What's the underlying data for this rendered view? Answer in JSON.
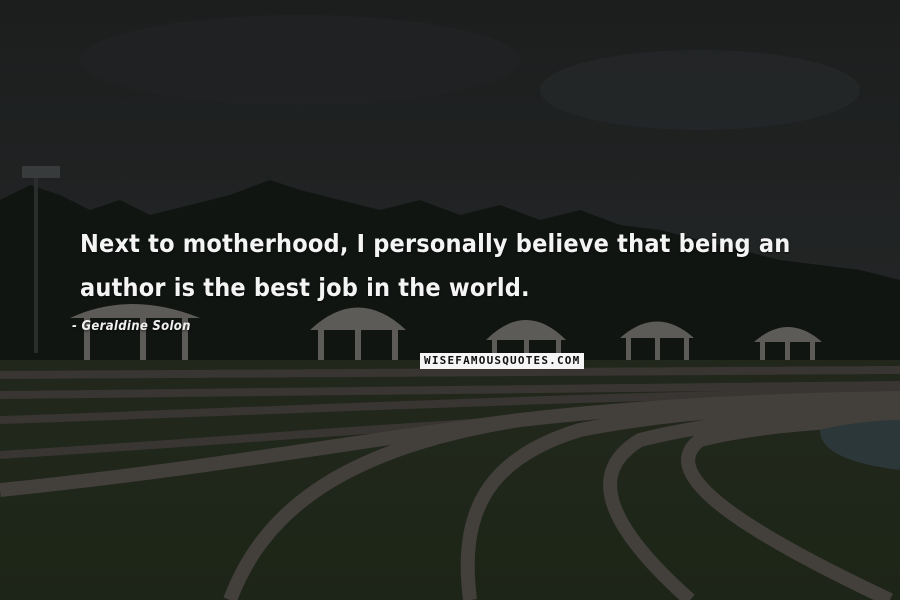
{
  "quote": {
    "text": "Next to motherhood, I personally believe that being an author is the best job in the world.",
    "author": "- Geraldine Solon"
  },
  "watermark": {
    "text": "WISEFAMOUSQUOTES.COM"
  },
  "background": {
    "description_icon": "park-amphitheater-photo",
    "sky_color": "#2a2c2d",
    "grass_color": "#2e3a26",
    "step_color": "#4a4541"
  }
}
